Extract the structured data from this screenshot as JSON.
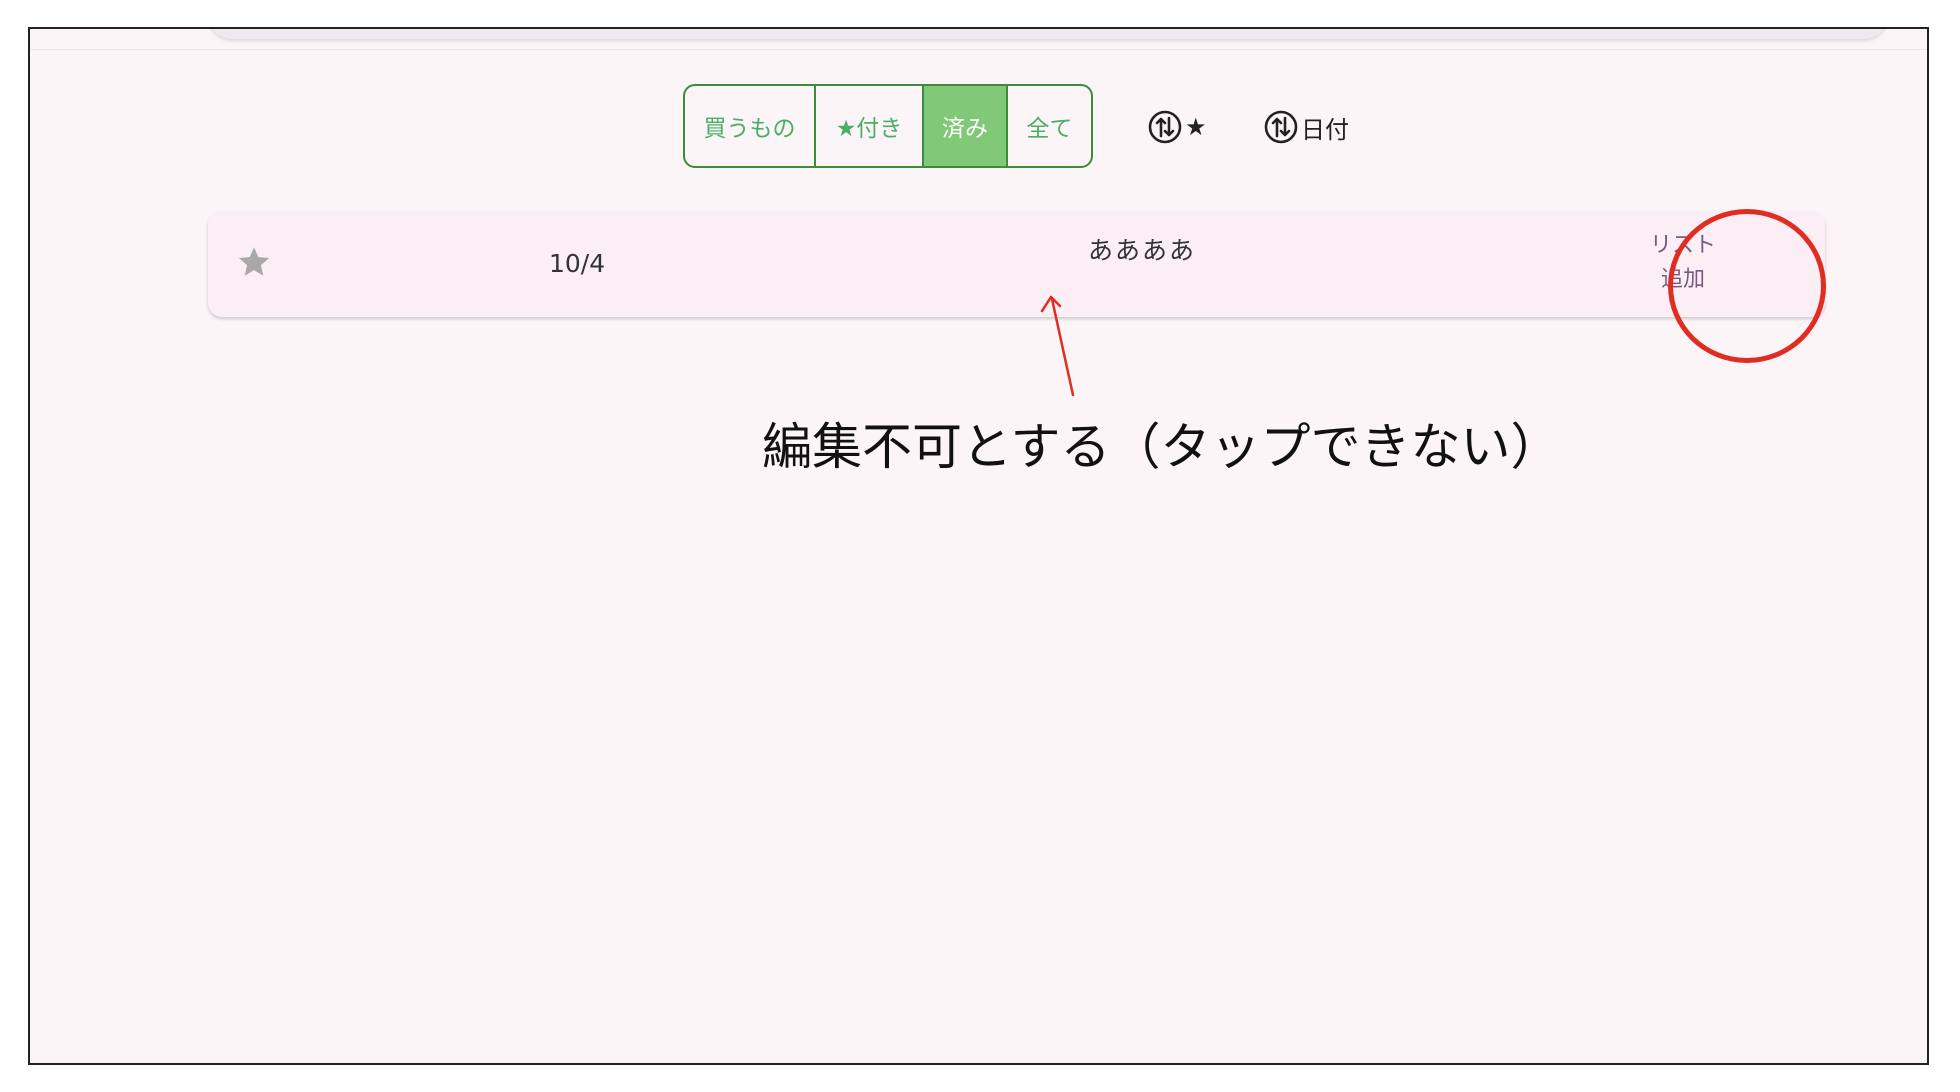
{
  "filter_tabs": [
    {
      "label": "買うもの",
      "active": false
    },
    {
      "label": "★付き",
      "active": false
    },
    {
      "label": "済み",
      "active": true
    },
    {
      "label": "全て",
      "active": false
    }
  ],
  "sort_controls": [
    {
      "icon": "sort-toggle-icon",
      "label": "★"
    },
    {
      "icon": "sort-toggle-icon",
      "label": "日付"
    }
  ],
  "item": {
    "star_icon": "star-icon",
    "starred": false,
    "date": "10/4",
    "name": "ああああ",
    "add_button_line1": "リスト",
    "add_button_line2": "追加"
  },
  "annotation": {
    "text": "編集不可とする（タップできない）",
    "color": "#e02d22"
  },
  "colors": {
    "accent_green": "#4cae65",
    "active_green": "#81c879",
    "border_green": "#3d8b3d",
    "background": "#fbf5f8"
  }
}
